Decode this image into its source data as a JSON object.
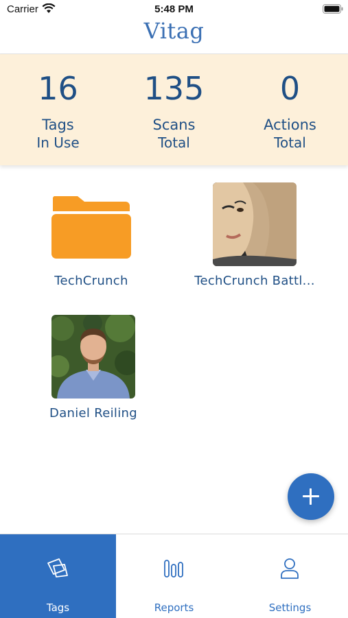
{
  "status_bar": {
    "carrier": "Carrier",
    "time": "5:48 PM"
  },
  "app": {
    "title": "Vitag"
  },
  "stats": [
    {
      "value": "16",
      "label": "Tags",
      "sub": "In Use"
    },
    {
      "value": "135",
      "label": "Scans",
      "sub": "Total"
    },
    {
      "value": "0",
      "label": "Actions",
      "sub": "Total"
    }
  ],
  "items": [
    {
      "label": "TechCrunch",
      "icon": "folder-icon"
    },
    {
      "label": "TechCrunch Battl...",
      "icon": "cartoon-thumbnail"
    },
    {
      "label": "Daniel Reiling",
      "icon": "person-photo"
    }
  ],
  "tabs": [
    {
      "label": "Tags",
      "icon": "tags-icon",
      "active": true
    },
    {
      "label": "Reports",
      "icon": "bars-icon",
      "active": false
    },
    {
      "label": "Settings",
      "icon": "user-icon",
      "active": false
    }
  ],
  "colors": {
    "accent": "#2f6fc0",
    "stats_bg": "#fdf0da",
    "folder": "#f79c25",
    "text_dark_blue": "#1f4f85"
  }
}
